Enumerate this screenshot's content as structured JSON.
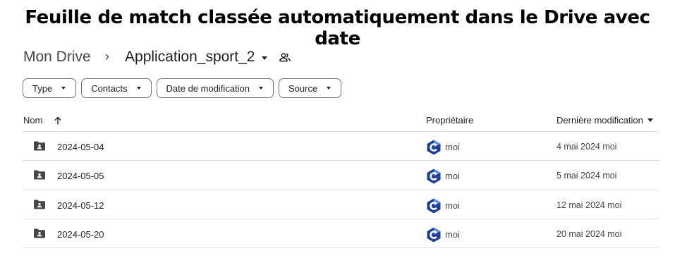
{
  "caption": "Feuille de match classée automatiquement dans le Drive avec date",
  "breadcrumb": {
    "root": "Mon Drive",
    "separator": "›",
    "current": "Application_sport_2",
    "shared_icon": "people-icon"
  },
  "filters": [
    "Type",
    "Contacts",
    "Date de modification",
    "Source"
  ],
  "table": {
    "col_name": "Nom",
    "col_owner": "Propriétaire",
    "col_modified": "Dernière modification",
    "sort_icon": "arrow-up-icon",
    "rows": [
      {
        "name": "2024-05-04",
        "owner": "moi",
        "modified": "4 mai 2024 moi",
        "icon": "shared-folder-icon"
      },
      {
        "name": "2024-05-05",
        "owner": "moi",
        "modified": "5 mai 2024 moi",
        "icon": "shared-folder-icon"
      },
      {
        "name": "2024-05-12",
        "owner": "moi",
        "modified": "12 mai 2024 moi",
        "icon": "shared-folder-icon"
      },
      {
        "name": "2024-05-20",
        "owner": "moi",
        "modified": "20 mai 2024 moi",
        "icon": "shared-folder-icon"
      }
    ]
  },
  "colors": {
    "avatar_dark": "#1e3f8f",
    "avatar_light": "#5b8fe0",
    "border": "#e1e3e1",
    "chip_border": "#747775"
  }
}
